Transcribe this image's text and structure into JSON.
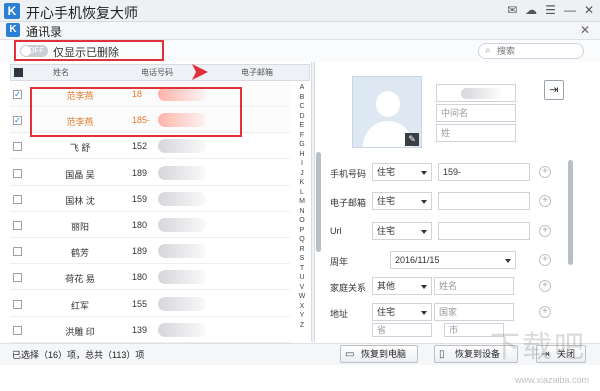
{
  "app": {
    "title": "开心手机恢复大师",
    "logo_letter": "K"
  },
  "window": {
    "controls": [
      "✉",
      "☁",
      "☰",
      "—",
      "✕"
    ]
  },
  "panel": {
    "title": "通讯录",
    "logo_letter": "K",
    "close": "✕"
  },
  "filter": {
    "toggle_state": "OFF",
    "label": "仅显示已删除"
  },
  "search": {
    "placeholder": "搜索"
  },
  "table": {
    "headers": {
      "name": "姓名",
      "phone": "电话号码",
      "email": "电子邮箱"
    },
    "rows": [
      {
        "name": "范李燕",
        "phone": "18",
        "checked": true
      },
      {
        "name": "范李燕",
        "phone": "185-",
        "checked": true
      },
      {
        "name": "飞 舒",
        "phone": "152",
        "checked": false
      },
      {
        "name": "国晶 吴",
        "phone": "189",
        "checked": false
      },
      {
        "name": "国林 沈",
        "phone": "159",
        "checked": false
      },
      {
        "name": "丽阳",
        "phone": "180",
        "checked": false
      },
      {
        "name": "鹤芳",
        "phone": "189",
        "checked": false
      },
      {
        "name": "荷花 易",
        "phone": "180",
        "checked": false
      },
      {
        "name": "红军",
        "phone": "155",
        "checked": false
      },
      {
        "name": "洪雕 印",
        "phone": "139",
        "checked": false
      }
    ]
  },
  "alphabet": [
    "A",
    "B",
    "C",
    "D",
    "E",
    "F",
    "G",
    "H",
    "I",
    "J",
    "K",
    "L",
    "M",
    "N",
    "O",
    "P",
    "Q",
    "R",
    "S",
    "T",
    "U",
    "V",
    "W",
    "X",
    "Y",
    "Z"
  ],
  "detail": {
    "middle_name_placeholder": "中间名",
    "last_name_placeholder": "姓",
    "edit_icon": "✎",
    "export_icon": "⇥",
    "labels": {
      "phone": "手机号码",
      "email": "电子邮箱",
      "url": "Url",
      "anniversary": "周年",
      "family": "家庭关系",
      "address": "地址"
    },
    "phone_type": "住宅",
    "phone_value": "159-",
    "email_type": "住宅",
    "url_type": "住宅",
    "anniversary_date": "2016/11/15",
    "family_type": "其他",
    "family_placeholder": "姓名",
    "address_type": "住宅",
    "country_placeholder": "国家",
    "province_placeholder": "省",
    "city_placeholder": "市"
  },
  "footer": {
    "status": "已选择（16）项，总共（113）项",
    "restore_pc": "恢复到电脑",
    "restore_device": "恢复到设备",
    "close": "关闭"
  },
  "watermark": {
    "text": "下载吧",
    "url": "www.xiazaiba.com"
  },
  "colors": {
    "accent_blue": "#2d7fd3",
    "highlight_red": "#e0303a",
    "selected_text": "#e07a2c"
  }
}
